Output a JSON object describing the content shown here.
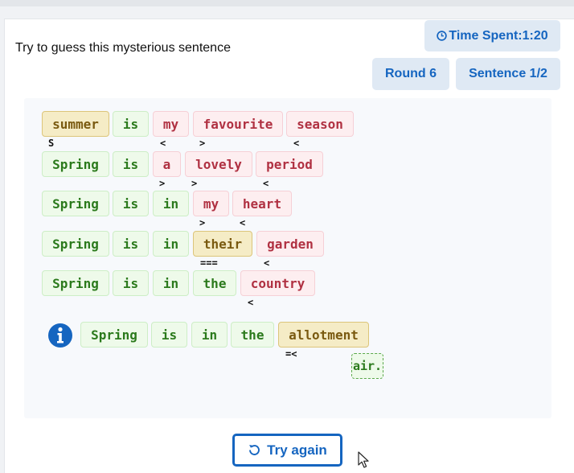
{
  "prompt": "Try to guess this mysterious sentence",
  "stats": {
    "time_label": "Time Spent:1:20",
    "round_label": "Round 6",
    "sentence_label": "Sentence 1/2"
  },
  "colors": {
    "correct": "#2b7a1c",
    "wrong": "#b03142",
    "present": "#7a5a10",
    "accent": "#1565c0"
  },
  "guesses": [
    {
      "words": [
        "summer",
        "is",
        "my",
        "favourite",
        "season"
      ],
      "status": [
        "present",
        "correct",
        "wrong",
        "wrong",
        "wrong"
      ],
      "hints": [
        "S",
        "",
        "<",
        ">",
        "<"
      ]
    },
    {
      "words": [
        "Spring",
        "is",
        "a",
        "lovely",
        "period"
      ],
      "status": [
        "correct",
        "correct",
        "wrong",
        "wrong",
        "wrong"
      ],
      "hints": [
        "",
        "",
        ">",
        ">",
        "<"
      ]
    },
    {
      "words": [
        "Spring",
        "is",
        "in",
        "my",
        "heart"
      ],
      "status": [
        "correct",
        "correct",
        "correct",
        "wrong",
        "wrong"
      ],
      "hints": [
        "",
        "",
        "",
        ">",
        "<"
      ]
    },
    {
      "words": [
        "Spring",
        "is",
        "in",
        "their",
        "garden"
      ],
      "status": [
        "correct",
        "correct",
        "correct",
        "present",
        "wrong"
      ],
      "hints": [
        "",
        "",
        "",
        "===",
        "<"
      ]
    },
    {
      "words": [
        "Spring",
        "is",
        "in",
        "the",
        "country"
      ],
      "status": [
        "correct",
        "correct",
        "correct",
        "correct",
        "wrong"
      ],
      "hints": [
        "",
        "",
        "",
        "",
        "<"
      ]
    }
  ],
  "current": {
    "icon": "info-icon",
    "words": [
      "Spring",
      "is",
      "in",
      "the",
      "allotment"
    ],
    "status": [
      "correct",
      "correct",
      "correct",
      "correct",
      "present"
    ],
    "hints": [
      "",
      "",
      "",
      "",
      "=<"
    ],
    "extra_word": "air."
  },
  "try_again_label": "Try again"
}
